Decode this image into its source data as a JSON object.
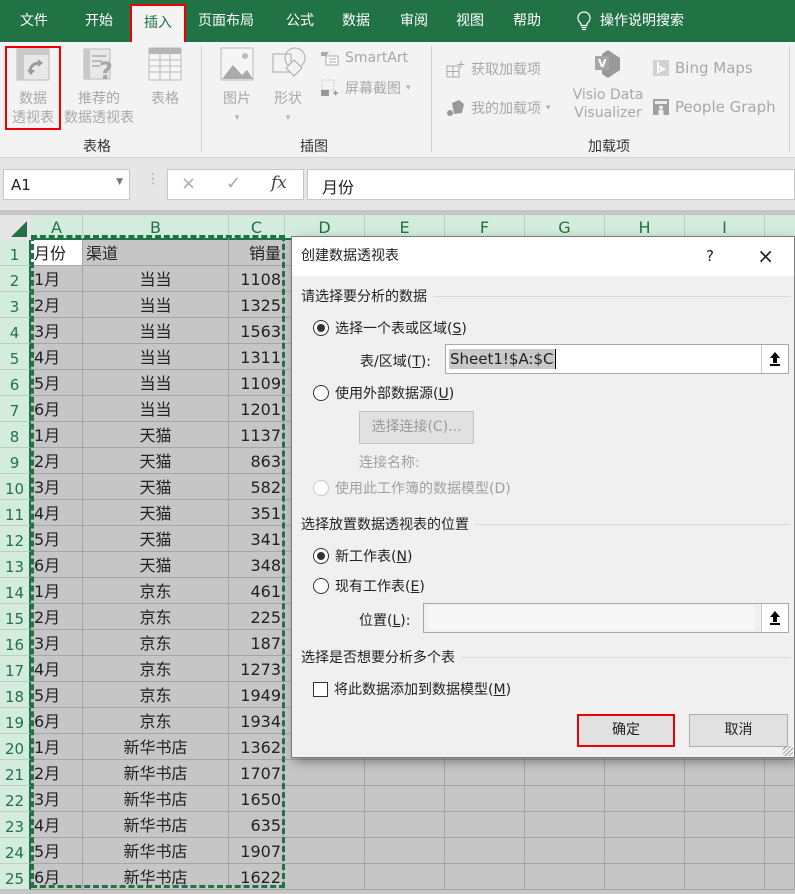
{
  "tabs": [
    {
      "label": "文件",
      "active": false
    },
    {
      "label": "开始",
      "active": false
    },
    {
      "label": "插入",
      "active": true
    },
    {
      "label": "页面布局",
      "active": false
    },
    {
      "label": "公式",
      "active": false
    },
    {
      "label": "数据",
      "active": false
    },
    {
      "label": "审阅",
      "active": false
    },
    {
      "label": "视图",
      "active": false
    },
    {
      "label": "帮助",
      "active": false
    }
  ],
  "tell_me": {
    "icon": "lightbulb-icon",
    "label": "操作说明搜索"
  },
  "ribbon": {
    "groups": {
      "tables": "表格",
      "illustrations": "插图",
      "addins": "加载项"
    },
    "pivot_table": {
      "line1": "数据",
      "line2": "透视表",
      "icon": "pivot-table-icon"
    },
    "recommended_pivot": {
      "line1": "推荐的",
      "line2": "数据透视表",
      "icon": "recommended-pivot-icon"
    },
    "table": {
      "label": "表格",
      "icon": "table-icon"
    },
    "pictures": {
      "label": "图片",
      "icon": "picture-icon"
    },
    "shapes": {
      "label": "形状",
      "icon": "shapes-icon"
    },
    "smartart": {
      "label": "SmartArt",
      "icon": "smartart-icon"
    },
    "screenshot": {
      "label": "屏幕截图",
      "icon": "screenshot-icon"
    },
    "get_addins": {
      "label": "获取加载项",
      "icon": "store-icon"
    },
    "my_addins": {
      "label": "我的加载项",
      "icon": "my-addins-icon"
    },
    "visio": {
      "line1": "Visio Data",
      "line2": "Visualizer",
      "icon": "visio-icon"
    },
    "bing_maps": {
      "label": "Bing Maps",
      "icon": "bing-icon"
    },
    "people_graph": {
      "label": "People Graph",
      "icon": "people-graph-icon"
    }
  },
  "formula_bar": {
    "name_box": "A1",
    "cancel": "×",
    "enter": "✓",
    "fx": "fx",
    "content": "月份"
  },
  "columns": [
    "A",
    "B",
    "C",
    "D",
    "E",
    "F",
    "G",
    "H",
    "I"
  ],
  "rows": [
    {
      "n": "1",
      "a": "月份",
      "b": "渠道",
      "c": "销量"
    },
    {
      "n": "2",
      "a": "1月",
      "b": "当当",
      "c": "1108"
    },
    {
      "n": "3",
      "a": "2月",
      "b": "当当",
      "c": "1325"
    },
    {
      "n": "4",
      "a": "3月",
      "b": "当当",
      "c": "1563"
    },
    {
      "n": "5",
      "a": "4月",
      "b": "当当",
      "c": "1311"
    },
    {
      "n": "6",
      "a": "5月",
      "b": "当当",
      "c": "1109"
    },
    {
      "n": "7",
      "a": "6月",
      "b": "当当",
      "c": "1201"
    },
    {
      "n": "8",
      "a": "1月",
      "b": "天猫",
      "c": "1137"
    },
    {
      "n": "9",
      "a": "2月",
      "b": "天猫",
      "c": "863"
    },
    {
      "n": "10",
      "a": "3月",
      "b": "天猫",
      "c": "582"
    },
    {
      "n": "11",
      "a": "4月",
      "b": "天猫",
      "c": "351"
    },
    {
      "n": "12",
      "a": "5月",
      "b": "天猫",
      "c": "341"
    },
    {
      "n": "13",
      "a": "6月",
      "b": "天猫",
      "c": "348"
    },
    {
      "n": "14",
      "a": "1月",
      "b": "京东",
      "c": "461"
    },
    {
      "n": "15",
      "a": "2月",
      "b": "京东",
      "c": "225"
    },
    {
      "n": "16",
      "a": "3月",
      "b": "京东",
      "c": "187"
    },
    {
      "n": "17",
      "a": "4月",
      "b": "京东",
      "c": "1273"
    },
    {
      "n": "18",
      "a": "5月",
      "b": "京东",
      "c": "1949"
    },
    {
      "n": "19",
      "a": "6月",
      "b": "京东",
      "c": "1934"
    },
    {
      "n": "20",
      "a": "1月",
      "b": "新华书店",
      "c": "1362"
    },
    {
      "n": "21",
      "a": "2月",
      "b": "新华书店",
      "c": "1707"
    },
    {
      "n": "22",
      "a": "3月",
      "b": "新华书店",
      "c": "1650"
    },
    {
      "n": "23",
      "a": "4月",
      "b": "新华书店",
      "c": "635"
    },
    {
      "n": "24",
      "a": "5月",
      "b": "新华书店",
      "c": "1907"
    },
    {
      "n": "25",
      "a": "6月",
      "b": "新华书店",
      "c": "1622"
    }
  ],
  "dialog": {
    "title": "创建数据透视表",
    "help": "?",
    "close": "×",
    "section1": "请选择要分析的数据",
    "opt_select_range": {
      "text": "选择一个表或区域(",
      "key": "S",
      "end": ")",
      "checked": true
    },
    "range_label": {
      "text": "表/区域(",
      "key": "T",
      "end": "):"
    },
    "range_value": "Sheet1!$A:$C",
    "opt_external": {
      "text": "使用外部数据源(",
      "key": "U",
      "end": ")",
      "checked": false
    },
    "choose_connection": "选择连接(C)...",
    "connection_name": "连接名称:",
    "opt_data_model": {
      "text": "使用此工作簿的数据模型(D)",
      "checked": false,
      "disabled": true
    },
    "section2": "选择放置数据透视表的位置",
    "opt_new_sheet": {
      "text": "新工作表(",
      "key": "N",
      "end": ")",
      "checked": true
    },
    "opt_existing_sheet": {
      "text": "现有工作表(",
      "key": "E",
      "end": ")",
      "checked": false
    },
    "location_label": {
      "text": "位置(",
      "key": "L",
      "end": "):"
    },
    "location_value": "",
    "section3": "选择是否想要分析多个表",
    "add_to_model": {
      "text": "将此数据添加到数据模型(",
      "key": "M",
      "end": ")",
      "checked": false
    },
    "ok": "确定",
    "cancel": "取消"
  },
  "highlight_color": "#ee0000",
  "accent_color": "#217346"
}
